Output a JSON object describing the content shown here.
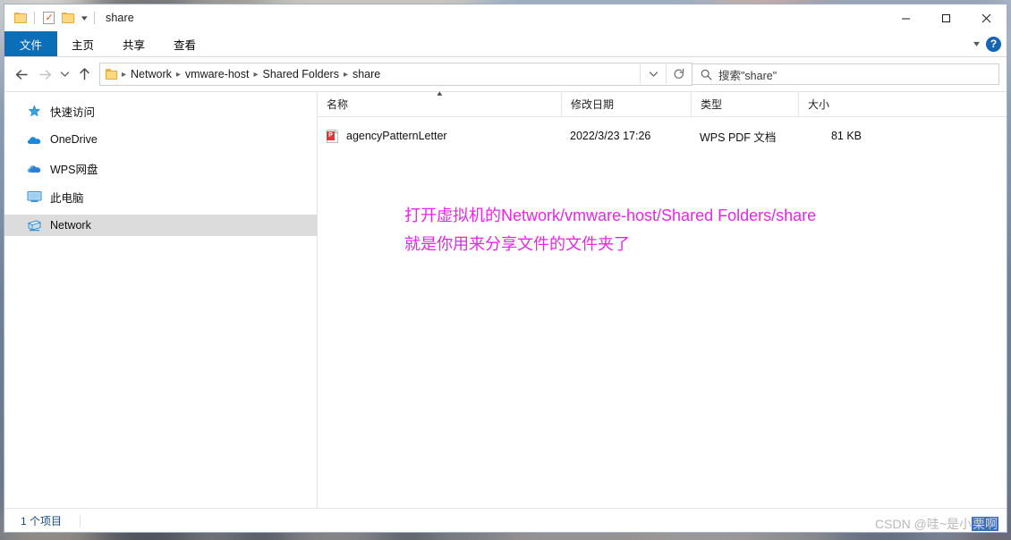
{
  "window": {
    "title": "share",
    "quick_access": [
      {
        "name": "folder-icon",
        "label": "文件夹"
      },
      {
        "name": "properties-icon",
        "label": "属性"
      },
      {
        "name": "new-folder-icon",
        "label": "新建文件夹"
      }
    ],
    "controls": {
      "minimize": "最小化",
      "maximize": "最大化",
      "close": "关闭"
    }
  },
  "ribbon": {
    "tabs": [
      {
        "label": "文件",
        "active": true
      },
      {
        "label": "主页",
        "active": false
      },
      {
        "label": "共享",
        "active": false
      },
      {
        "label": "查看",
        "active": false
      }
    ],
    "collapse_icon": "chevron-down-icon",
    "help_label": "?"
  },
  "navbar": {
    "back": "后退",
    "forward": "前进",
    "recent": "最近浏览的位置",
    "up": "向上",
    "breadcrumbs": [
      "Network",
      "vmware-host",
      "Shared Folders",
      "share"
    ],
    "dropdown_label": "展开",
    "refresh_label": "刷新"
  },
  "search": {
    "placeholder": "搜索\"share\"",
    "icon": "search-icon"
  },
  "sidebar": {
    "items": [
      {
        "label": "快速访问",
        "icon": "star-icon",
        "selected": false
      },
      {
        "label": "OneDrive",
        "icon": "cloud-icon",
        "selected": false
      },
      {
        "label": "WPS网盘",
        "icon": "cloud-icon",
        "selected": false
      },
      {
        "label": "此电脑",
        "icon": "monitor-icon",
        "selected": false
      },
      {
        "label": "Network",
        "icon": "network-icon",
        "selected": true
      }
    ]
  },
  "filelist": {
    "columns": [
      {
        "label": "名称",
        "sorted": "asc"
      },
      {
        "label": "修改日期",
        "sorted": ""
      },
      {
        "label": "类型",
        "sorted": ""
      },
      {
        "label": "大小",
        "sorted": ""
      }
    ],
    "rows": [
      {
        "name": "agencyPatternLetter",
        "date": "2022/3/23 17:26",
        "type": "WPS PDF 文档",
        "size": "81 KB",
        "icon": "pdf-file-icon",
        "badge": "P"
      }
    ]
  },
  "annotation": {
    "line1": "打开虚拟机的Network/vmware-host/Shared Folders/share",
    "line2": "就是你用来分享文件的文件夹了",
    "color": "#e826e8"
  },
  "statusbar": {
    "item_count": "1 个项目"
  },
  "watermark": {
    "prefix": "CSDN @哇~是小",
    "suffix": "栗啊"
  }
}
